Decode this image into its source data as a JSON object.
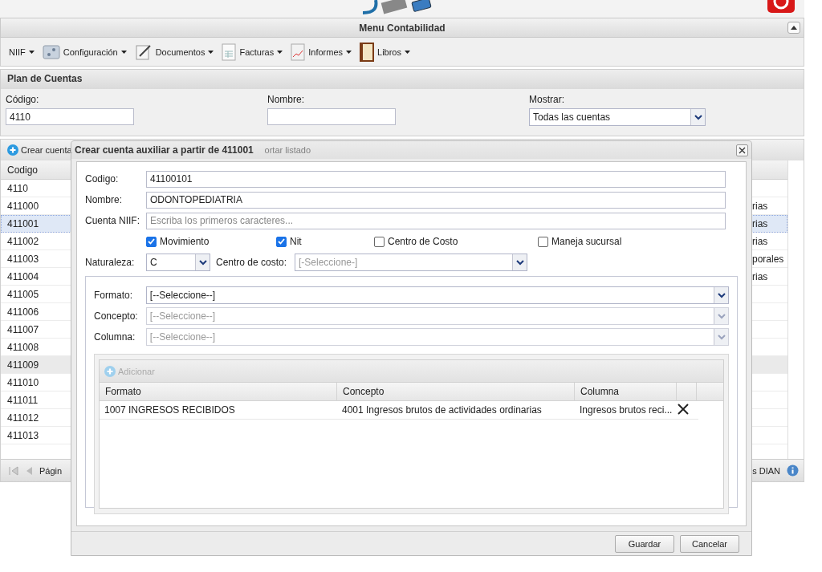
{
  "header": {
    "title": "Menu Contabilidad"
  },
  "menu": [
    {
      "label": "NIIF",
      "kind": "plain"
    },
    {
      "label": "Configuración",
      "kind": "config"
    },
    {
      "label": "Documentos",
      "kind": "document"
    },
    {
      "label": "Facturas",
      "kind": "invoice"
    },
    {
      "label": "Informes",
      "kind": "report"
    },
    {
      "label": "Libros",
      "kind": "book"
    }
  ],
  "filters": {
    "title": "Plan de Cuentas",
    "codigo_label": "Código:",
    "codigo_value": "4110",
    "nombre_label": "Nombre:",
    "mostrar_label": "Mostrar:",
    "mostrar_value": "Todas las cuentas"
  },
  "grid": {
    "toolbar": [
      {
        "label": "Crear cuenta",
        "kind": "add"
      },
      {
        "label": "ortar listado",
        "kind": "faded"
      }
    ],
    "column_1": "Codigo",
    "rows": [
      {
        "codigo": "4110",
        "selected": false,
        "hovered": false
      },
      {
        "codigo": "411000",
        "column_2": "rias",
        "selected": false,
        "hovered": false
      },
      {
        "codigo": "411001",
        "column_2": "rias",
        "selected": true,
        "hovered": false
      },
      {
        "codigo": "411002",
        "column_2": "rias",
        "selected": false,
        "hovered": false
      },
      {
        "codigo": "411003",
        "column_2": "porales",
        "selected": false,
        "hovered": false
      },
      {
        "codigo": "411004",
        "column_2": "rias",
        "selected": false,
        "hovered": false
      },
      {
        "codigo": "411005",
        "selected": false,
        "hovered": false
      },
      {
        "codigo": "411006",
        "selected": false,
        "hovered": false
      },
      {
        "codigo": "411007",
        "selected": false,
        "hovered": false
      },
      {
        "codigo": "411008",
        "selected": false,
        "hovered": false
      },
      {
        "codigo": "411009",
        "selected": false,
        "hovered": true
      },
      {
        "codigo": "411010",
        "selected": false,
        "hovered": false
      },
      {
        "codigo": "411011",
        "selected": false,
        "hovered": false
      },
      {
        "codigo": "411012",
        "selected": false,
        "hovered": false
      },
      {
        "codigo": "411013",
        "selected": false,
        "hovered": false
      }
    ],
    "pager_label": "Págin",
    "footer_right": "s DIAN"
  },
  "dialog": {
    "title": "Crear cuenta auxiliar a partir de 411001",
    "codigo_label": "Codigo:",
    "codigo_value": "41100101",
    "nombre_label": "Nombre:",
    "nombre_value": "ODONTOPEDIATRIA",
    "niif_label": "Cuenta NIIF:",
    "niif_placeholder": "Escriba los primeros caracteres...",
    "checkboxes": [
      {
        "label": "Movimiento",
        "checked": true
      },
      {
        "label": "Nit",
        "checked": true
      },
      {
        "label": "Centro de Costo",
        "checked": false
      },
      {
        "label": "Maneja sucursal",
        "checked": false
      }
    ],
    "naturaleza_label": "Naturaleza:",
    "naturaleza_value": "C",
    "centro_label": "Centro de costo:",
    "centro_value": "[-Seleccione-]",
    "selects": [
      {
        "label": "Formato:",
        "value": "[--Seleccione--]",
        "disabled": false
      },
      {
        "label": "Concepto:",
        "value": "[--Seleccione--]",
        "disabled": true
      },
      {
        "label": "Columna:",
        "value": "[--Seleccione--]",
        "disabled": true
      }
    ],
    "add_button": {
      "label": "Adicionar",
      "disabled": true
    },
    "table": {
      "columns": [
        "Formato",
        "Concepto",
        "Columna"
      ],
      "rows": [
        {
          "formato": "1007 INGRESOS RECIBIDOS",
          "concepto": "4001 Ingresos brutos de actividades ordinarias",
          "columna": "Ingresos brutos reci..."
        }
      ]
    },
    "buttons": [
      "Guardar",
      "Cancelar"
    ]
  }
}
